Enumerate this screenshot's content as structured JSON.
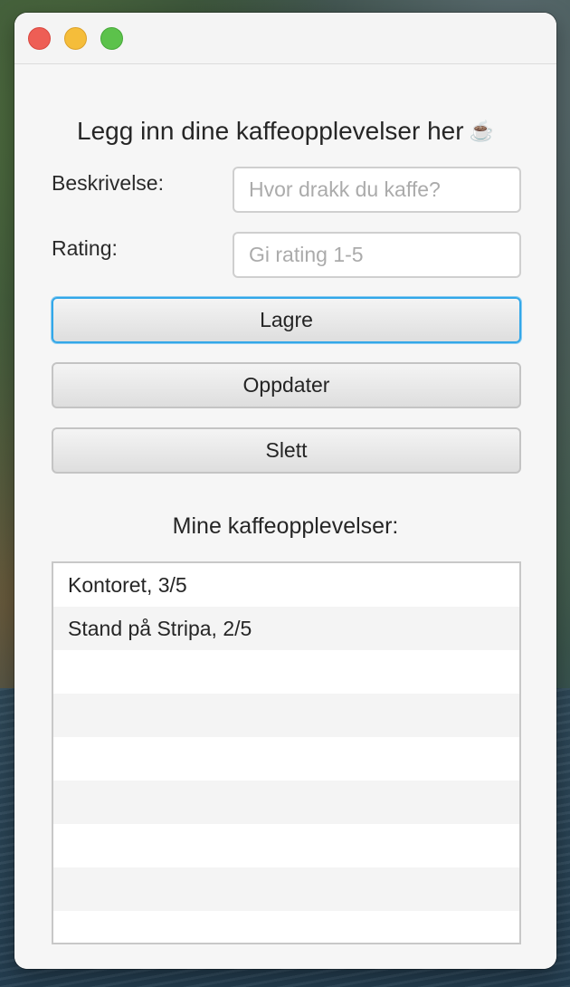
{
  "window": {
    "heading": "Legg inn dine kaffeopplevelser her",
    "heading_icon": "☕"
  },
  "form": {
    "description_label": "Beskrivelse:",
    "description_placeholder": "Hvor drakk du kaffe?",
    "description_value": "",
    "rating_label": "Rating:",
    "rating_placeholder": "Gi rating 1-5",
    "rating_value": ""
  },
  "buttons": {
    "save": "Lagre",
    "update": "Oppdater",
    "delete": "Slett"
  },
  "list": {
    "heading": "Mine kaffeopplevelser:",
    "items": [
      "Kontoret, 3/5",
      "Stand på Stripa, 2/5",
      "",
      "",
      "",
      "",
      "",
      "",
      ""
    ]
  },
  "colors": {
    "focus_ring": "#33a7e8",
    "close": "#ee5e55",
    "minimize": "#f5bd3a",
    "maximize": "#5cc24b"
  }
}
